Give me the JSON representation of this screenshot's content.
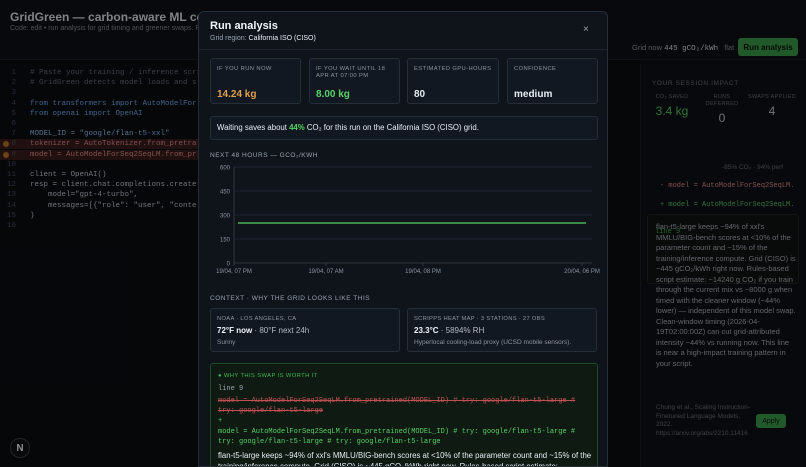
{
  "app": {
    "title": "GridGreen — carbon-aware ML copilot",
    "subtitle": "Code: edit • run analysis for grid timing and greener swaps. Re",
    "grid_now_label": "Grid now",
    "grid_now_value": "445 gCO₂/kWh",
    "grid_trend": "flat",
    "run_button": "Run analysis"
  },
  "editor": {
    "lines": [
      {
        "n": "1",
        "text": "# Paste your training / inference scri",
        "cls": "c-com"
      },
      {
        "n": "2",
        "text": "# GridGreen detects model loads and s",
        "cls": "c-com"
      },
      {
        "n": "3",
        "text": "",
        "cls": "c-txt"
      },
      {
        "n": "4",
        "text": "from transformers import AutoModelFor",
        "cls": "c-kw"
      },
      {
        "n": "5",
        "text": "from openai import OpenAI",
        "cls": "c-kw"
      },
      {
        "n": "6",
        "text": "",
        "cls": "c-txt"
      },
      {
        "n": "7",
        "text": "MODEL_ID = \"google/flan-t5-xxl\"",
        "cls": "c-str"
      },
      {
        "n": "8",
        "text": "tokenizer = AutoTokenizer.from_pretra",
        "cls": "c-red"
      },
      {
        "n": "9",
        "text": "model = AutoModelForSeq2SeqLM.from_pr",
        "cls": "c-red"
      },
      {
        "n": "10",
        "text": "",
        "cls": "c-txt"
      },
      {
        "n": "11",
        "text": "client = OpenAI()",
        "cls": "c-txt"
      },
      {
        "n": "12",
        "text": "resp = client.chat.completions.create",
        "cls": "c-txt"
      },
      {
        "n": "13",
        "text": "    model=\"gpt-4-turbo\",",
        "cls": "c-txt"
      },
      {
        "n": "14",
        "text": "    messages=[{\"role\": \"user\", \"conte",
        "cls": "c-txt"
      },
      {
        "n": "15",
        "text": ")",
        "cls": "c-txt"
      },
      {
        "n": "16",
        "text": "",
        "cls": "c-txt"
      }
    ],
    "logo": "N"
  },
  "side": {
    "title": "YOUR SESSION IMPACT",
    "stats": [
      {
        "label": "CO₂ SAVED",
        "value": "3.4 kg"
      },
      {
        "label": "RUNS DEFERRED",
        "value": "0"
      },
      {
        "label": "SWAPS APPLIED",
        "value": "4"
      }
    ],
    "tag": "line 9",
    "perf": "-85% CO₂ · 94% perf",
    "del": "- model = AutoModelForSeq2SeqLM.",
    "add": "+ model = AutoModelForSeq2SeqLM.",
    "body": "flan-t5-large keeps ~94% of xxl's MMLU/BIG-bench scores at <10% of the parameter count and ~15% of the training/inference compute. Grid (CISO) is ~445 gCO₂/kWh right now. Rules-based script estimate: ~14240 g CO₂ if you train through the current mix vs ~8000 g when timed with the cleaner window (~44% lower) — independent of this model swap. Clean-window timing (2026-04-19T02:00:00Z) can cut grid-attributed intensity ~44% vs running now. This line is near a high-impact training pattern in your script.",
    "cite": "Chung et al., Scaling Instruction-Finetuned Language Models, 2022. https://arxiv.org/abs/2210.11416",
    "apply": "Apply"
  },
  "modal": {
    "title": "Run analysis",
    "region_label": "Grid region:",
    "region": "California ISO (CISO)",
    "close": "×",
    "cards": [
      {
        "label": "IF YOU RUN NOW",
        "value": "14.24 kg"
      },
      {
        "label": "IF YOU WAIT UNTIL 18 APR AT 07:00 PM",
        "value": "8.00 kg"
      },
      {
        "label": "ESTIMATED GPU-HOURS",
        "value": "80"
      },
      {
        "label": "CONFIDENCE",
        "value": "medium"
      }
    ],
    "savings_pre": "Waiting saves about ",
    "savings_pct": "44%",
    "savings_post": " CO₂ for this run on the California ISO (CISO) grid.",
    "chart_label": "NEXT 48 HOURS — GCO₂/KWH",
    "context_label": "CONTEXT · WHY THE GRID LOOKS LIKE THIS",
    "noaa": {
      "label": "NOAA · LOS ANGELES, CA",
      "value_main": "72°F now",
      "value_rest": " · 80°F next 24h",
      "sub": "Sunny"
    },
    "scripps": {
      "label": "SCRIPPS HEAT MAP · 3 STATIONS · 27 OBS",
      "value_main": "23.3°C",
      "value_rest": " · 5894% RH",
      "sub": "Hyperlocal cooling-load proxy (UCSD mobile sensors)."
    },
    "swap": {
      "head": "WHY THIS SWAP IS WORTH IT",
      "line": "line 9",
      "del": "model = AutoModelForSeq2SeqLM.from_pretrained(MODEL_ID) # try: google/flan-t5-large # try: google/flan-t5-large",
      "plus": "+",
      "add": "model = AutoModelForSeq2SeqLM.from_pretrained(MODEL_ID) # try: google/flan-t5-large # try: google/flan-t5-large # try: google/flan-t5-large",
      "body": "flan-t5-large keeps ~94% of xxl's MMLU/BIG-bench scores at <10% of the parameter count and ~15% of the training/inference compute. Grid (CISO) is ~445 gCO₂/kWh right now. Rules-based script estimate:"
    }
  },
  "colors": {
    "accent": "#3fa34d",
    "line": "#56d364",
    "orange": "#e3a04b"
  },
  "chart_data": {
    "type": "line",
    "xlabel": "",
    "ylabel": "",
    "x_start": "2026-04-19T04:00",
    "x_step_hours": 1,
    "x_ticks": [
      "19/04, 07 PM",
      "19/04, 07 AM",
      "19/04, 08 PM",
      "20/04, 06 PM"
    ],
    "yticks": [
      0,
      150,
      300,
      450,
      600
    ],
    "ylim": [
      0,
      600
    ],
    "grid": true,
    "series": [
      {
        "values": [
          250,
          250,
          250,
          250,
          250,
          250,
          250,
          250,
          250,
          250,
          250,
          250,
          250,
          250,
          250,
          250,
          250,
          250,
          250,
          250,
          250,
          250,
          250,
          250,
          250,
          250,
          250,
          250,
          250,
          250,
          250,
          250,
          250,
          250,
          250,
          250,
          250,
          250,
          250,
          250,
          250,
          250,
          250,
          250,
          250,
          250,
          250,
          250
        ]
      }
    ]
  }
}
